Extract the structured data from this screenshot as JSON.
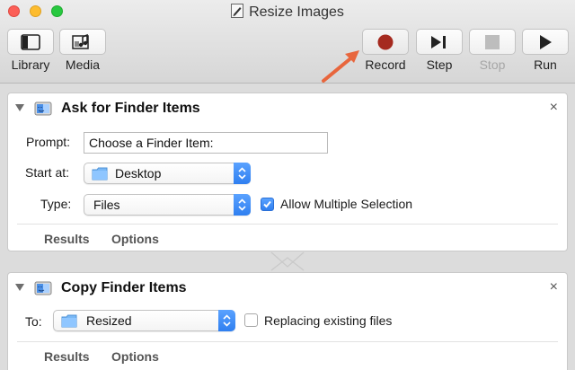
{
  "window": {
    "title": "Resize Images"
  },
  "toolbar": {
    "library_label": "Library",
    "media_label": "Media",
    "record_label": "Record",
    "step_label": "Step",
    "stop_label": "Stop",
    "run_label": "Run",
    "record_color": "#a52a1f"
  },
  "actions": [
    {
      "title": "Ask for Finder Items",
      "prompt_label": "Prompt:",
      "prompt_value": "Choose a Finder Item:",
      "start_label": "Start at:",
      "start_value": "Desktop",
      "type_label": "Type:",
      "type_value": "Files",
      "allow_multiple_label": "Allow Multiple Selection",
      "allow_multiple_checked": true,
      "results_label": "Results",
      "options_label": "Options"
    },
    {
      "title": "Copy Finder Items",
      "to_label": "To:",
      "to_value": "Resized",
      "replace_label": "Replacing existing files",
      "replace_checked": false,
      "results_label": "Results",
      "options_label": "Options"
    }
  ],
  "icons": {
    "close_glyph": "×"
  },
  "colors": {
    "accent": "#2f7ff0",
    "annotation_arrow": "#e8663d"
  }
}
